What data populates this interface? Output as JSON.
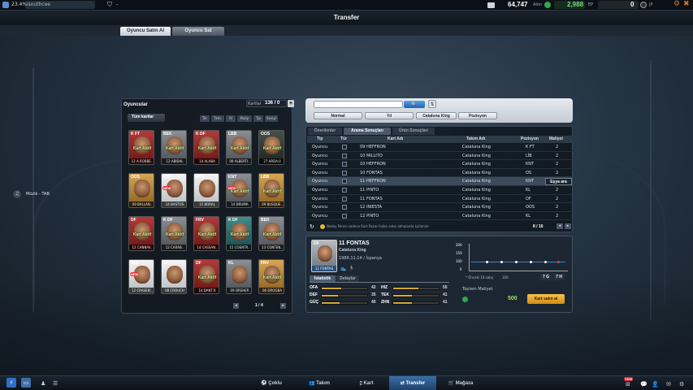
{
  "topbar": {
    "level_percent": "23.4%",
    "username": "isouthcee",
    "shield_text": "-",
    "currency_1": "64,747",
    "currency_1_label": "Altın",
    "currency_2": "2,988",
    "currency_2_label": "EP",
    "currency_3": "0",
    "currency_3_label": "JP"
  },
  "title": "Transfer",
  "main_tabs": [
    "Oyuncu Satın Al",
    "Oyuncu Sat"
  ],
  "side_label": "Müzik - TAB",
  "players_panel": {
    "title": "Oyuncular",
    "kart_label": "Kartlar",
    "kart_count": "136 / 0",
    "plus": "+",
    "all_cards": "Tüm kartlar",
    "filters": [
      "Tür",
      "Tkm.",
      "Yıl",
      "Poziy",
      "Tip",
      "Seviyi"
    ],
    "cards": [
      {
        "pos": "K FT",
        "active": "Kart Aktif",
        "name": "12 A.ROBBE..",
        "color": "red",
        "new": false
      },
      {
        "pos": "BEK",
        "active": "Kart Aktif",
        "name": "12 ABIDAL",
        "color": "grey",
        "new": false
      },
      {
        "pos": "K DF",
        "active": "Kart Aktif",
        "name": "14 ALABA",
        "color": "red",
        "new": false
      },
      {
        "pos": "LBB",
        "active": "Kart Aktif",
        "name": "09 ALBERTI..",
        "color": "grey",
        "new": false
      },
      {
        "pos": "OOS",
        "active": "Kart Aktif",
        "name": "27 ARDA.0",
        "color": "dark",
        "new": false
      },
      {
        "pos": "OOS",
        "active": "",
        "name": "09 BALLAN..",
        "color": "gold",
        "new": false
      },
      {
        "pos": "KNT",
        "active": "",
        "name": "14 BASTOS",
        "color": "white",
        "new": true
      },
      {
        "pos": "KNT",
        "active": "",
        "name": "15 BORAL",
        "color": "white",
        "new": false
      },
      {
        "pos": "KNT",
        "active": "Kart Aktif",
        "name": "14 BRUMA",
        "color": "grey",
        "new": true
      },
      {
        "pos": "LBB",
        "active": "Kart Aktif",
        "name": "09 BUSQUE..",
        "color": "gold",
        "new": false
      },
      {
        "pos": "DF",
        "active": "Kart Aktif",
        "name": "12 CANNAV..",
        "color": "red",
        "new": false
      },
      {
        "pos": "K DF",
        "active": "Kart Aktif",
        "name": "12 CARAB..",
        "color": "grey",
        "new": false
      },
      {
        "pos": "FRV",
        "active": "Kart Aktif",
        "name": "14 CASSAN..",
        "color": "red",
        "new": false
      },
      {
        "pos": "K DF",
        "active": "Kart Aktif",
        "name": "15 COENTR..",
        "color": "teal",
        "new": false
      },
      {
        "pos": "BEK",
        "active": "Kart Aktif",
        "name": "13 CONTEN..",
        "color": "grey",
        "new": false
      },
      {
        "pos": "BEK",
        "active": "",
        "name": "12 CRASEKI..",
        "color": "white",
        "new": true
      },
      {
        "pos": "GF",
        "active": "",
        "name": "08 CROUCH",
        "color": "white",
        "new": false
      },
      {
        "pos": "DF",
        "active": "Kart Aktif",
        "name": "14 DANT.R",
        "color": "red",
        "new": false
      },
      {
        "pos": "KL",
        "active": "",
        "name": "09 DREHER",
        "color": "grey",
        "new": false
      },
      {
        "pos": "FRV",
        "active": "Kart Aktif",
        "name": "06 DROGBA",
        "color": "gold",
        "new": false
      }
    ],
    "page": "1 / 4"
  },
  "search": {
    "placeholder": "",
    "dropdowns": [
      "Normal",
      "Yıl",
      "Cataluna King",
      "Pozisyon"
    ]
  },
  "results": {
    "tabs": [
      "Önerilenler",
      "Arama Sonuçları",
      "Ürün Sonuçları"
    ],
    "headers": [
      "Tip",
      "Tür",
      "Kart Adı",
      "Takım Adı",
      "Pozisyon",
      "Maliyet"
    ],
    "rows": [
      {
        "tip": "Oyuncu",
        "name": "09 HEFFRON",
        "team": "Cataluna King",
        "pos": "K FT",
        "cost": "2"
      },
      {
        "tip": "Oyuncu",
        "name": "10 MILLITO",
        "team": "Cataluna King",
        "pos": "LİB",
        "cost": "2"
      },
      {
        "tip": "Oyuncu",
        "name": "10 HEFFRON",
        "team": "Cataluna King",
        "pos": "KNT",
        "cost": "2"
      },
      {
        "tip": "Oyuncu",
        "name": "10 FONTAS",
        "team": "Cataluna King",
        "pos": "OS",
        "cost": "2"
      },
      {
        "tip": "Oyuncu",
        "name": "11 HEFFRON",
        "team": "Cataluna King",
        "pos": "KNT",
        "cost": "2"
      },
      {
        "tip": "Oyuncu",
        "name": "11 PINTO",
        "team": "Cataluna King",
        "pos": "KL",
        "cost": "2"
      },
      {
        "tip": "Oyuncu",
        "name": "11 FONTAS",
        "team": "Cataluna King",
        "pos": "DF",
        "cost": "2"
      },
      {
        "tip": "Oyuncu",
        "name": "12 INIESTA",
        "team": "Cataluna King",
        "pos": "OOS",
        "cost": "2"
      },
      {
        "tip": "Oyuncu",
        "name": "12 PINTO",
        "team": "Cataluna King",
        "pos": "KL",
        "cost": "2"
      }
    ],
    "search_button": "Eşya ara",
    "footer_note": "Nakey Parası sadece Kart Pazarı'ndan satın almalarda kullanılır.",
    "page": "8 / 16"
  },
  "detail": {
    "card_pos": "DF",
    "card_name": "11 FONTAS",
    "title": "11 FONTAS",
    "team": "Cataluna King",
    "info": "1989.11.14 / İspanya",
    "tabs": [
      "İstatistik",
      "Detaylar"
    ],
    "stats": [
      {
        "label": "OFA",
        "value": "42",
        "fill": 0.42
      },
      {
        "label": "DEF",
        "value": "35",
        "fill": 0.35
      },
      {
        "label": "GÜÇ",
        "value": "40",
        "fill": 0.4
      },
      {
        "label": "HIZ",
        "value": "55",
        "fill": 0.55
      },
      {
        "label": "TEK",
        "value": "41",
        "fill": 0.41
      },
      {
        "label": "ZHN",
        "value": "41",
        "fill": 0.41
      }
    ],
    "graph_y": [
      "200",
      "150",
      "100",
      "0"
    ],
    "graph_note": "* Önceki 10 satış",
    "graph_value": "100",
    "graph_btns": [
      "7 G",
      "7 H"
    ],
    "total_label": "Toplam Maliyet",
    "total_value": "500",
    "buy_button": "Kart satın al"
  },
  "bottom_nav": [
    "Çoklu",
    "Takım",
    "Kart",
    "Transfer",
    "Mağaza"
  ],
  "bottom_badge": "YENİ"
}
